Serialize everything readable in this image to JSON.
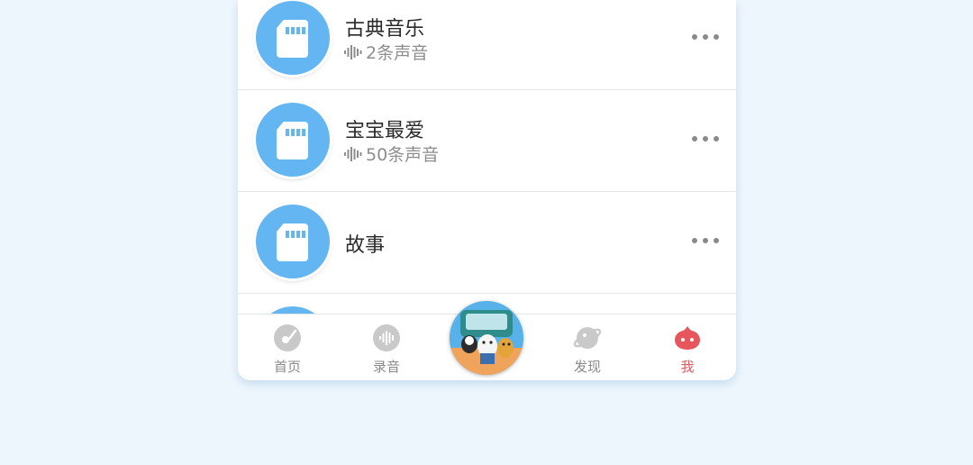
{
  "list": [
    {
      "title": "古典音乐",
      "subtitle": "2条声音"
    },
    {
      "title": "宝宝最爱",
      "subtitle": "50条声音"
    },
    {
      "title": "故事",
      "subtitle": ""
    }
  ],
  "tabs": [
    {
      "label": "首页",
      "icon": "disc-icon"
    },
    {
      "label": "录音",
      "icon": "soundwave-icon"
    },
    {
      "label": "发现",
      "icon": "planet-icon"
    },
    {
      "label": "我",
      "icon": "mascot-icon",
      "active": true
    }
  ],
  "colors": {
    "accent": "#63b6f1",
    "active": "#e7555d",
    "background": "#eef6fd"
  }
}
